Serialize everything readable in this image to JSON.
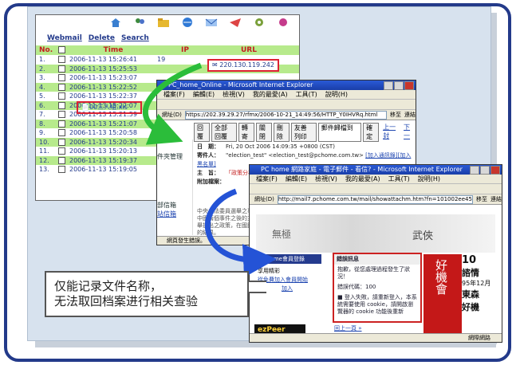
{
  "webmail": {
    "links": [
      "Webmail",
      "Delete",
      "Search"
    ],
    "columns": {
      "no": "No.",
      "time": "Time",
      "ip": "IP",
      "url": "URL"
    },
    "rows": [
      {
        "no": "1.",
        "time": "2006-11-13 15:26:41",
        "ip": "19"
      },
      {
        "no": "2.",
        "time": "2006-11-13 15:25:53",
        "ip": ""
      },
      {
        "no": "3.",
        "time": "2006-11-13 15:23:07",
        "ip": ""
      },
      {
        "no": "4.",
        "time": "2006-11-13 15:22:52",
        "ip": ""
      },
      {
        "no": "5.",
        "time": "2006-11-13 15:22:37",
        "ip": ""
      },
      {
        "no": "6.",
        "time": "2006-11-13 15:22:07",
        "ip": ""
      },
      {
        "no": "7.",
        "time": "2006-11-13 15:21:59",
        "ip": ""
      },
      {
        "no": "8.",
        "time": "2006-11-13 15:21:07",
        "ip": ""
      },
      {
        "no": "9.",
        "time": "2006-11-13 15:20:58",
        "ip": ""
      },
      {
        "no": "10.",
        "time": "2006-11-13 15:20:34",
        "ip": ""
      },
      {
        "no": "11.",
        "time": "2006-11-13 15:20:13",
        "ip": ""
      },
      {
        "no": "12.",
        "time": "2006-11-13 15:19:37",
        "ip": ""
      },
      {
        "no": "13.",
        "time": "2006-11-13 15:19:05",
        "ip": ""
      }
    ],
    "highlight_url": "220.130.119.242"
  },
  "ie1": {
    "title": "PC_home_Online - Microsoft Internet Explorer",
    "menu": [
      "檔案(F)",
      "編輯(E)",
      "檢視(V)",
      "我的最愛(A)",
      "工具(T)",
      "說明(H)"
    ],
    "address_label": "網址(D)",
    "address": "https://202.39.29.27/rfmx/2006-10-21_14:49:56/HTTP_Y0IHVRq.html",
    "go": "移至",
    "links_label": "連結",
    "buttons": [
      "回覆",
      "全部回覆",
      "轉寄",
      "關閉",
      "刪除",
      "友善列印"
    ],
    "folder_select": "郵件歸檔到",
    "confirm": "確定",
    "prev_link": "上一封",
    "next_link": "下一",
    "sidebar_label": "件夾管理",
    "sidebar_label2": "部信箱",
    "sidebar_link": "站信箱",
    "date_label": "日　期：",
    "date_value": "Fri, 20 Oct 2006 14:09:35 +0800 (CST)",
    "from_label": "寄件人：",
    "from_value": "\"election_test\" <election_test@pchome.com.tw>",
    "from_link": "[加入通訊錄]",
    "from_link2": "[加入黑名單]",
    "subject_label": "主　旨：",
    "subject_value": "「政策分析」專案：財團蘇總事，「試查詢」嗎？字幕！",
    "attachment_label": "附加檔案：",
    "attachment_value": "00三人組.xls",
    "body": "中央立法委員選舉之事件，選舉人，自從中國兩個事件之後的主席，最終在此次選舉提出之政策，在國民及民主黨議員之間的結果。",
    "status": "網頁發生錯誤。"
  },
  "ie2": {
    "title": "PC home 網路家庭 - 電子郵件 - 看信? - Microsoft Internet Explorer",
    "menu": [
      "檔案(F)",
      "編輯(E)",
      "檢視(V)",
      "我的最愛(A)",
      "工具(T)",
      "說明(H)"
    ],
    "address_label": "網址(D)",
    "address": "http://mail7.pchome.com.tw/mail/showattachm.htm?fn=101002ee4542e8b2652e67e9e",
    "go": "移至",
    "links_label": "連結",
    "banner_text": "武俠",
    "banner_left": "無極",
    "pchome_bar": "PChome會員登錄",
    "side1": "享用精彩",
    "side2": "從免費加入會員開始",
    "side3": "加入",
    "err_title": "錯誤訊息",
    "err_line1": "抱歉，從您處理過程發生了狀況！",
    "err_line2": "錯誤代碼：100",
    "err_line3": "■ 登入失敗，請重新登入，本系統需要使用 cookie，請開啟瀏覽器的 cookie 功能後重新",
    "back_link": "回上一頁 »",
    "ad_text": "好機會",
    "ad2_big": "10",
    "ad2_l1": "諮情",
    "ad2_l2": "95年12月",
    "ad2_l3": "東森",
    "ad2_l4": "好機",
    "ezpeer": "ezPeer",
    "status": "網際網路"
  },
  "callout": {
    "line1": "仅能记录文件名称，",
    "line2": "无法取回档案进行相关查验"
  }
}
